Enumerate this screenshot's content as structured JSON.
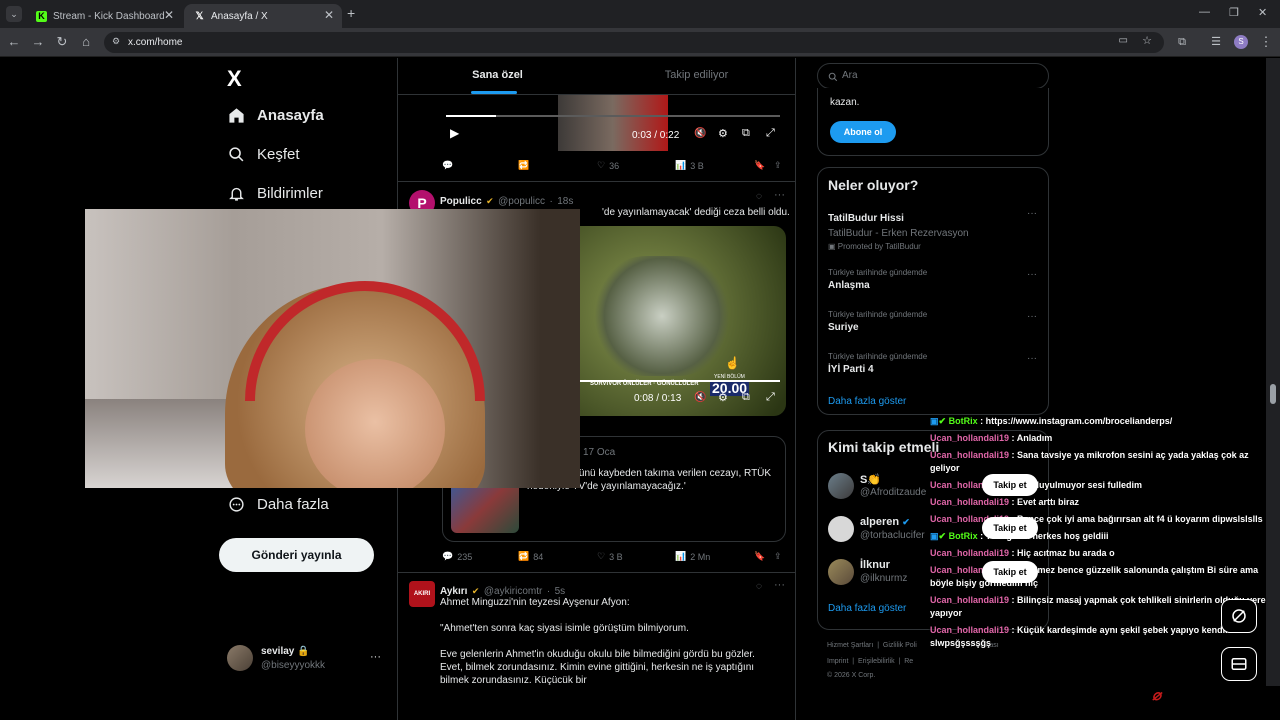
{
  "browser": {
    "tabs": [
      {
        "title": "Stream - Kick Dashboard",
        "active": false
      },
      {
        "title": "Anasayfa / X",
        "active": true
      }
    ],
    "new_tab_label": "+",
    "url": "x.com/home",
    "profile_initial": "S"
  },
  "sidebar": {
    "logo": "X",
    "items": [
      {
        "label": "Anasayfa",
        "icon": "home-icon"
      },
      {
        "label": "Keşfet",
        "icon": "search-icon"
      },
      {
        "label": "Bildirimler",
        "icon": "bell-icon"
      },
      {
        "label": "Daha fazla",
        "icon": "more-circle-icon"
      }
    ],
    "post_button": "Gönderi yayınla",
    "account": {
      "name": "sevilay",
      "handle": "@biseyyyokkk",
      "more": "···"
    }
  },
  "feed": {
    "tabs": [
      "Sana özel",
      "Takip ediliyor"
    ],
    "video1": {
      "time": "0:03 / 0:22",
      "progress": 0.15
    },
    "post1_actions": {
      "replies": "",
      "reposts": "",
      "likes": "36",
      "views": "3 B"
    },
    "post2": {
      "name": "Populicc",
      "handle": "@populicc",
      "time": "18s",
      "text": "'Pazartesi günü kaybeden takıma verilen cezayı, RTÜK nedeniyle TV'de yayınlamayacağız.' dediği ceza belli oldu.",
      "text_visible_start": "'de yayınlamayacak' dediği ceza belli oldu.",
      "video_time": "0:08 / 0:13",
      "video_progress": 1.0,
      "overlay_caption": "SURVIVOR ÜNLÜLER · GÖNÜLLÜLER",
      "overlay_badge_top": "YENİ BÖLÜM",
      "overlay_badge": "20.00",
      "quote_date": "17 Oca",
      "quote_text": "'Pazartesi günü kaybeden takıma verilen cezayı, RTÜK nedeniyle TV'de yayınlamayacağız.'",
      "actions": {
        "replies": "235",
        "reposts": "84",
        "likes": "3 B",
        "views": "2 Mn"
      }
    },
    "post3": {
      "name": "Aykırı",
      "handle": "@aykiricomtr",
      "time": "5s",
      "avatar_text": "AKIRI",
      "lines": [
        "Ahmet Minguzzi'nin teyzesi Ayşenur Afyon:",
        "",
        "\"Ahmet'ten sonra kaç siyasi isimle görüştüm bilmiyorum.",
        "",
        "Eve gelenlerin Ahmet'in okuduğu okulu bile bilmediğini gördü bu gözler.",
        "Evet, bilmek zorundasınız. Kimin evine gittiğini, herkesin ne iş yaptığını",
        "bilmek zorundasınız. Küçücük bir"
      ]
    }
  },
  "right": {
    "search_placeholder": "Ara",
    "premium_text": "kazan.",
    "subscribe_button": "Abone ol",
    "trends_title": "Neler oluyor?",
    "trends": [
      {
        "meta": "",
        "title": "TatilBudur Hissi",
        "sub": "TatilBudur - Erken Rezervasyon",
        "promo": "Promoted by TatilBudur"
      },
      {
        "meta": "Türkiye tarihinde gündemde",
        "title": "Anlaşma"
      },
      {
        "meta": "Türkiye tarihinde gündemde",
        "title": "Suriye"
      },
      {
        "meta": "Türkiye tarihinde gündemde",
        "title": "İYİ Parti 4"
      }
    ],
    "trends_more": "Daha fazla göster",
    "who_title": "Kimi takip etmeli",
    "who": [
      {
        "name": "S👏",
        "handle": "@Afroditzaude"
      },
      {
        "name": "alperen",
        "handle": "@torbaclucifer",
        "verified": true
      },
      {
        "name": "İlknur",
        "handle": "@ilknurmz"
      }
    ],
    "follow_label": "Takip et",
    "who_more": "Daha fazla göster",
    "footer": [
      "Hizmet Şartları",
      "Gizlilik Poli",
      "Politikası",
      "Imprint",
      "Erişilebilirlik",
      "Re",
      "© 2026 X Corp."
    ]
  },
  "chat": [
    {
      "user": "BotRix",
      "bot": true,
      "msg": "https://www.instagram.com/brocelianderps/"
    },
    {
      "user": "Ucan_hollandali19",
      "msg": "Anladım"
    },
    {
      "user": "Ucan_hollandali19",
      "msg": "Sana tavsiye ya mikrofon sesini aç yada yaklaş çok az geliyor"
    },
    {
      "user": "Ucan_hollandali19",
      "msg": "Hiç duyulmuyor sesi fulledim"
    },
    {
      "user": "Ucan_hollandali19",
      "msg": "Evet arttı biraz"
    },
    {
      "user": "Ucan_hollandali19",
      "msg": "Bence çok iyi ama bağırırsan alt f4 ü koyarım dipwslslslls"
    },
    {
      "user": "BotRix",
      "bot": true,
      "msg": "Yeni gelen herkes hoş geldiii"
    },
    {
      "user": "Ucan_hollandali19",
      "msg": "Hiç acıtmaz bu arada o"
    },
    {
      "user": "Ucan_hollandali19",
      "msg": "Gerilmez bence güzzelik salonunda çalıştım Bi süre ama böyle bişiy görmedim hiç"
    },
    {
      "user": "Ucan_hollandali19",
      "msg": "Bilinçsiz masaj yapmak çok tehlikeli sinirlerin olduğu yere yapıyor"
    },
    {
      "user": "Ucan_hollandali19",
      "msg": "Küçük kardeşimde aynı şekil şebek yapıyo kendini slwpsğşssşğş"
    }
  ],
  "colors": {
    "accent": "#1d9bf0",
    "chat_user": "#e066a8",
    "bot": "#53fc18",
    "kick": "#53fc18"
  }
}
